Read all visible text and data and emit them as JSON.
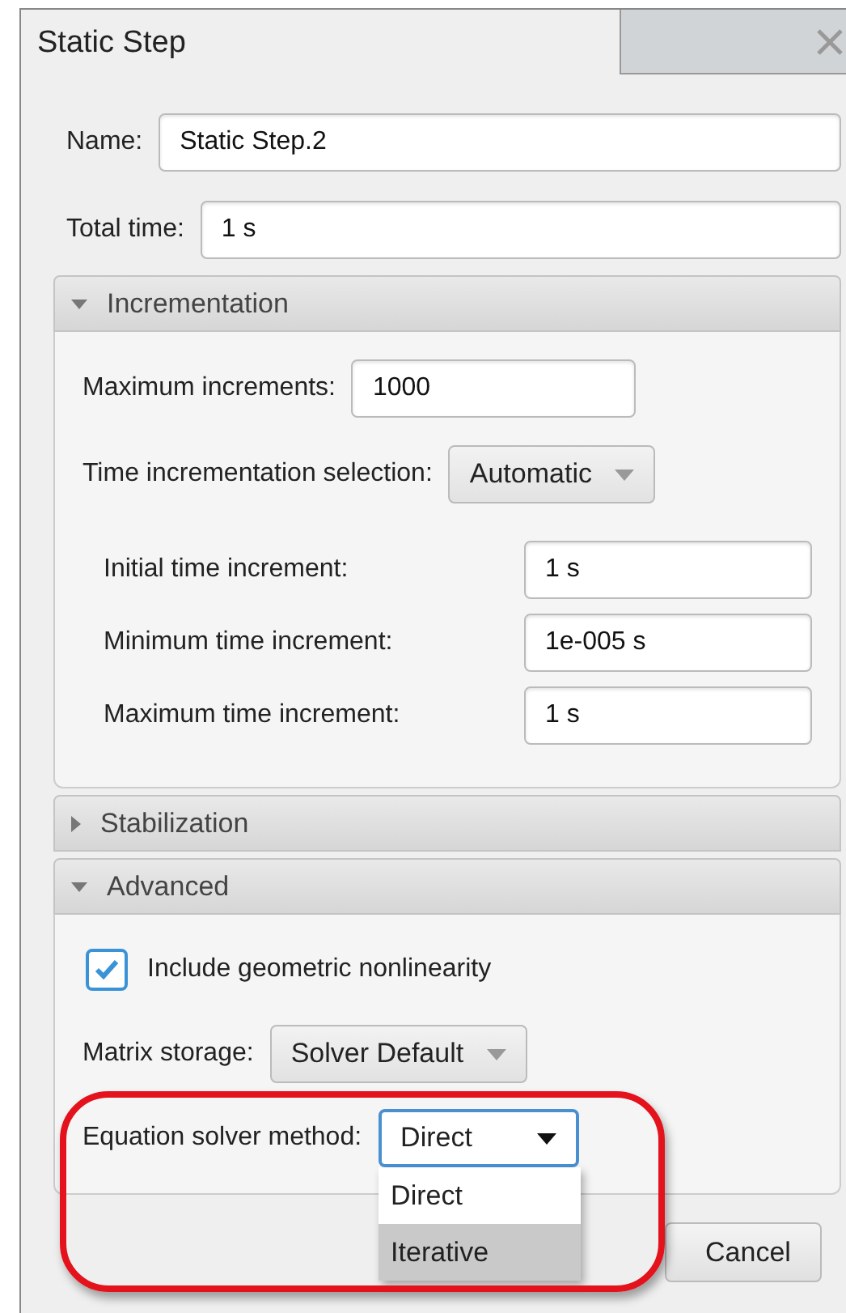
{
  "window": {
    "title": "Static Step"
  },
  "fields": [
    {
      "label": "Name:",
      "value": "Static Step.2"
    },
    {
      "label": "Total time:",
      "value": "1 s"
    }
  ],
  "sections": [
    {
      "title": "Incrementation",
      "expanded": true,
      "rows": [
        {
          "kind": "field",
          "label": "Maximum increments:",
          "value": "1000"
        },
        {
          "kind": "dropdown",
          "label": "Time incrementation selection:",
          "value": "Automatic"
        },
        {
          "kind": "subfield",
          "label": "Initial time increment:",
          "value": "1 s"
        },
        {
          "kind": "subfield",
          "label": "Minimum time increment:",
          "value": "1e-005 s"
        },
        {
          "kind": "subfield",
          "label": "Maximum time increment:",
          "value": "1 s"
        }
      ]
    },
    {
      "title": "Stabilization",
      "expanded": false
    },
    {
      "title": "Advanced",
      "expanded": true,
      "rows": [
        {
          "kind": "checkbox",
          "label": "Include geometric nonlinearity",
          "checked": true
        },
        {
          "kind": "dropdown",
          "label": "Matrix storage:",
          "value": "Solver Default"
        },
        {
          "kind": "dropdown",
          "label": "Equation solver method:",
          "value": "Direct",
          "open": true,
          "options": [
            {
              "label": "Direct",
              "highlighted": false
            },
            {
              "label": "Iterative",
              "highlighted": true
            }
          ]
        }
      ]
    }
  ],
  "buttons": [
    {
      "label": "Cancel"
    }
  ]
}
